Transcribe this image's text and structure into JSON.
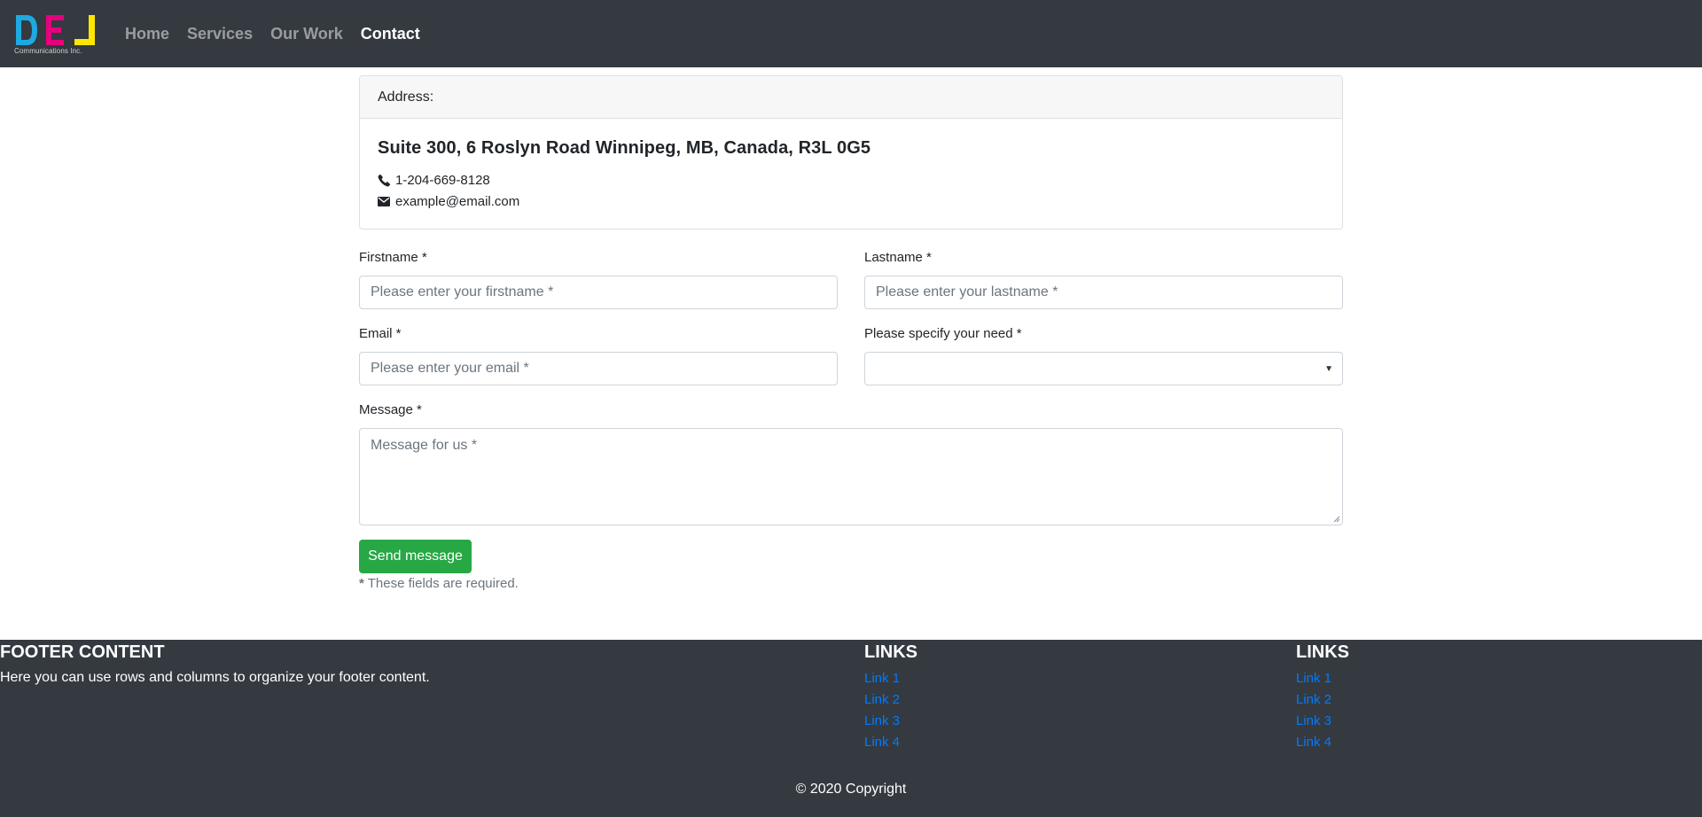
{
  "navbar": {
    "logo_subtitle": "Communications Inc.",
    "links": [
      {
        "label": "Home",
        "active": false
      },
      {
        "label": "Services",
        "active": false
      },
      {
        "label": "Our Work",
        "active": false
      },
      {
        "label": "Contact",
        "active": true
      }
    ]
  },
  "address_card": {
    "header": "Address:",
    "address": "Suite 300, 6 Roslyn Road Winnipeg, MB, Canada, R3L 0G5",
    "phone": "1-204-669-8128",
    "email": "example@email.com"
  },
  "form": {
    "firstname": {
      "label": "Firstname *",
      "placeholder": "Please enter your firstname *",
      "value": ""
    },
    "lastname": {
      "label": "Lastname *",
      "placeholder": "Please enter your lastname *",
      "value": ""
    },
    "email": {
      "label": "Email *",
      "placeholder": "Please enter your email *",
      "value": ""
    },
    "need": {
      "label": "Please specify your need *",
      "selected": ""
    },
    "message": {
      "label": "Message *",
      "placeholder": "Message for us *",
      "value": ""
    },
    "submit_label": "Send message",
    "required_star": "*",
    "required_note": " These fields are required."
  },
  "footer": {
    "content_title": "FOOTER CONTENT",
    "content_text": "Here you can use rows and columns to organize your footer content.",
    "links_col_1": {
      "title": "LINKS",
      "links": [
        "Link 1",
        "Link 2",
        "Link 3",
        "Link 4"
      ]
    },
    "links_col_2": {
      "title": "LINKS",
      "links": [
        "Link 1",
        "Link 2",
        "Link 3",
        "Link 4"
      ]
    },
    "copyright": "© 2020 Copyright"
  },
  "colors": {
    "navbar_bg": "#343a40",
    "footer_bg": "#343a40",
    "button_green": "#28a745",
    "link_blue": "#007bff",
    "logo_cyan": "#1ea9e1",
    "logo_magenta": "#e6007e",
    "logo_yellow": "#ffe600"
  }
}
